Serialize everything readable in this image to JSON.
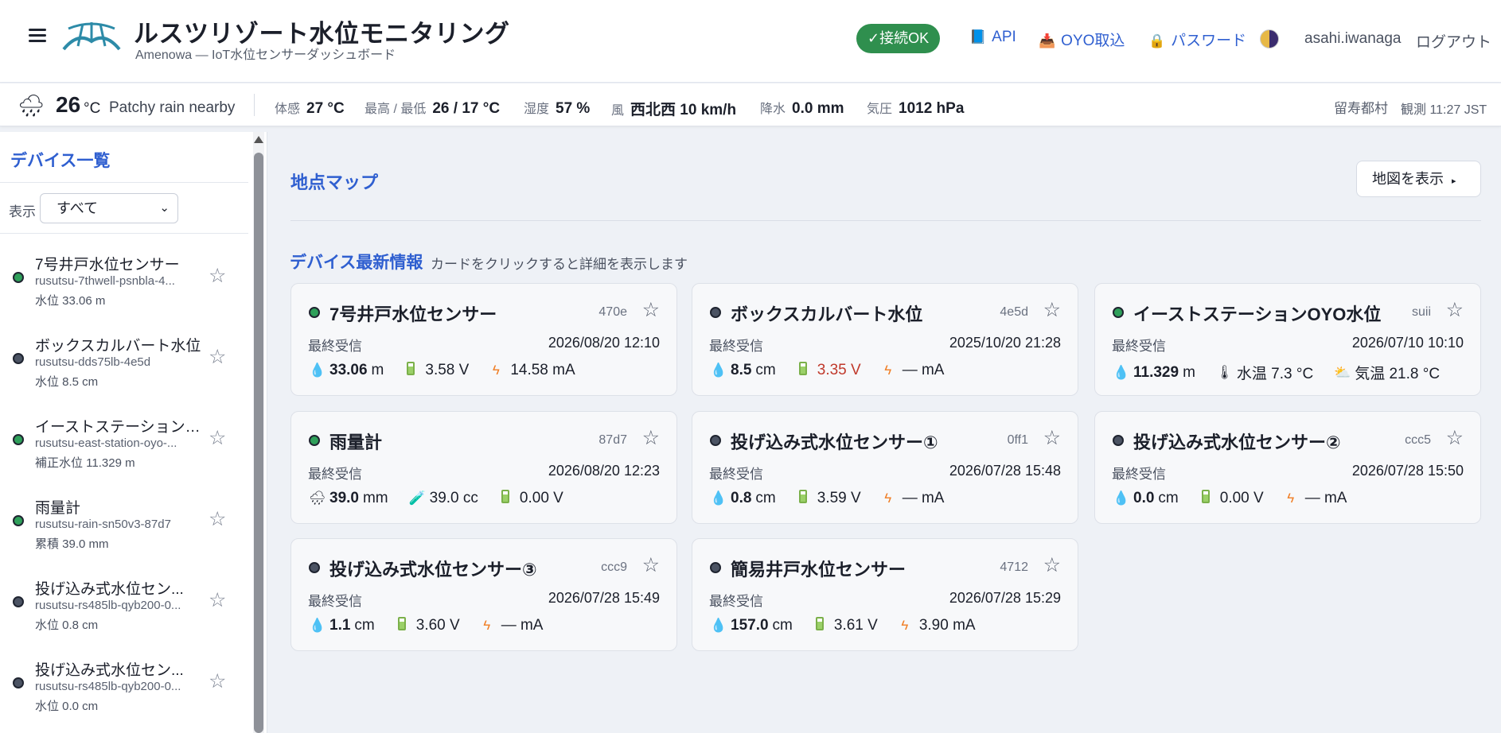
{
  "header": {
    "title": "ルスツリゾート水位モニタリング",
    "subtitle": "Amenowa — IoT水位センサーダッシュボード",
    "connection_status": "✓接続OK",
    "nav": [
      {
        "label": "API",
        "icon": "📘"
      },
      {
        "label": "OYO取込",
        "icon": "📥"
      },
      {
        "label": "パスワード",
        "icon": "🔒"
      }
    ],
    "user": "asahi.iwanaga",
    "logout": "ログアウト"
  },
  "weather": {
    "icon": "🌧",
    "temp": "26",
    "temp_unit": "°C",
    "condition": "Patchy rain nearby",
    "stats": [
      {
        "label": "体感",
        "value": "27 °C"
      },
      {
        "label": "最高 / 最低",
        "value": "26 / 17 °C"
      },
      {
        "label": "湿度",
        "value": "57 %"
      },
      {
        "label": "風",
        "value": "西北西 10 km/h"
      },
      {
        "label": "降水",
        "value": "0.0 mm"
      },
      {
        "label": "気圧",
        "value": "1012 hPa"
      }
    ],
    "location": "留寿都村",
    "observed": "観測 11:27 JST"
  },
  "sidebar": {
    "title": "デバイス一覧",
    "filter_label": "表示",
    "filter_value": "すべて",
    "items": [
      {
        "name": "7号井戸水位センサー",
        "id": "rusutsu-7thwell-psnbla-4...",
        "value": "水位 33.06 m",
        "status": "online"
      },
      {
        "name": "ボックスカルバート水位",
        "id": "rusutsu-dds75lb-4e5d",
        "value": "水位 8.5 cm",
        "status": "offline"
      },
      {
        "name": "イーストステーションOY...",
        "id": "rusutsu-east-station-oyo-...",
        "value": "補正水位 11.329 m",
        "status": "online"
      },
      {
        "name": "雨量計",
        "id": "rusutsu-rain-sn50v3-87d7",
        "value": "累積 39.0 mm",
        "status": "online"
      },
      {
        "name": "投げ込み式水位セン...",
        "id": "rusutsu-rs485lb-qyb200-0...",
        "value": "水位 0.8 cm",
        "status": "offline"
      },
      {
        "name": "投げ込み式水位セン...",
        "id": "rusutsu-rs485lb-qyb200-0...",
        "value": "水位 0.0 cm",
        "status": "offline"
      }
    ]
  },
  "main": {
    "map_title": "地点マップ",
    "map_button": "地図を表示",
    "latest_title": "デバイス最新情報",
    "latest_hint": "カードをクリックすると詳細を表示します",
    "last_received_label": "最終受信",
    "cards": [
      {
        "name": "7号井戸水位センサー",
        "code": "470e",
        "status": "online",
        "time": "2026/08/20 12:10",
        "metrics": [
          {
            "icon": "drop",
            "value": "33.06",
            "unit": "m"
          },
          {
            "icon": "battery",
            "value": "",
            "unit": "3.58 V"
          },
          {
            "icon": "bolt",
            "value": "",
            "unit": "14.58 mA"
          }
        ]
      },
      {
        "name": "ボックスカルバート水位",
        "code": "4e5d",
        "status": "offline",
        "time": "2025/10/20 21:28",
        "metrics": [
          {
            "icon": "drop",
            "value": "8.5",
            "unit": "cm"
          },
          {
            "icon": "battery",
            "value": "",
            "unit": "3.35 V",
            "warn": true
          },
          {
            "icon": "bolt",
            "value": "",
            "unit": "— mA"
          }
        ]
      },
      {
        "name": "イーストステーションOYO水位",
        "code": "suii",
        "status": "online",
        "time": "2026/07/10 10:10",
        "metrics": [
          {
            "icon": "drop",
            "value": "11.329",
            "unit": "m"
          },
          {
            "icon": "thermo",
            "value": "",
            "unit": "水温 7.3 °C"
          },
          {
            "icon": "sun",
            "value": "",
            "unit": "気温 21.8 °C"
          }
        ]
      },
      {
        "name": "雨量計",
        "code": "87d7",
        "status": "online",
        "time": "2026/08/20 12:23",
        "metrics": [
          {
            "icon": "rain",
            "value": "39.0",
            "unit": "mm"
          },
          {
            "icon": "tube",
            "value": "",
            "unit": "39.0 cc"
          },
          {
            "icon": "battery",
            "value": "",
            "unit": "0.00 V"
          }
        ]
      },
      {
        "name": "投げ込み式水位センサー①",
        "code": "0ff1",
        "status": "offline",
        "time": "2026/07/28 15:48",
        "metrics": [
          {
            "icon": "drop",
            "value": "0.8",
            "unit": "cm"
          },
          {
            "icon": "battery",
            "value": "",
            "unit": "3.59 V"
          },
          {
            "icon": "bolt",
            "value": "",
            "unit": "— mA"
          }
        ]
      },
      {
        "name": "投げ込み式水位センサー②",
        "code": "ccc5",
        "status": "offline",
        "time": "2026/07/28 15:50",
        "metrics": [
          {
            "icon": "drop",
            "value": "0.0",
            "unit": "cm"
          },
          {
            "icon": "battery",
            "value": "",
            "unit": "0.00 V"
          },
          {
            "icon": "bolt",
            "value": "",
            "unit": "— mA"
          }
        ]
      },
      {
        "name": "投げ込み式水位センサー③",
        "code": "ccc9",
        "status": "offline",
        "time": "2026/07/28 15:49",
        "metrics": [
          {
            "icon": "drop",
            "value": "1.1",
            "unit": "cm"
          },
          {
            "icon": "battery",
            "value": "",
            "unit": "3.60 V"
          },
          {
            "icon": "bolt",
            "value": "",
            "unit": "— mA"
          }
        ]
      },
      {
        "name": "簡易井戸水位センサー",
        "code": "4712",
        "status": "offline",
        "time": "2026/07/28 15:29",
        "metrics": [
          {
            "icon": "drop",
            "value": "157.0",
            "unit": "cm"
          },
          {
            "icon": "battery",
            "value": "",
            "unit": "3.61 V"
          },
          {
            "icon": "bolt",
            "value": "",
            "unit": "3.90 mA"
          }
        ]
      }
    ]
  },
  "colors": {
    "accent": "#2f5fd0",
    "online": "#2fa05a",
    "offline": "#4b5363",
    "connected": "#2f8f4e",
    "warning": "#c0392b"
  }
}
